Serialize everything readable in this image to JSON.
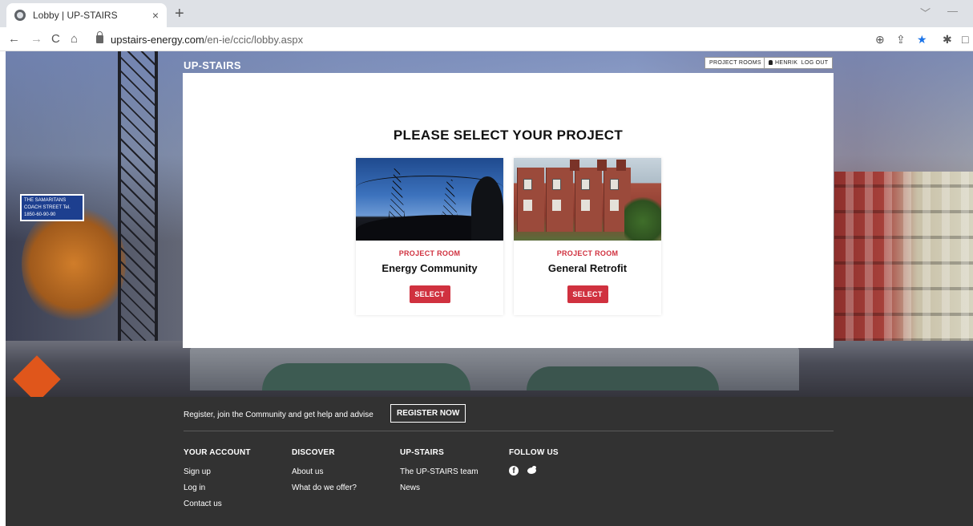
{
  "browser": {
    "tab_title": "Lobby | UP-STAIRS",
    "tab_close": "×",
    "new_tab": "+",
    "url_domain": "upstairs-energy.com",
    "url_path": "/en-ie/ccic/lobby.aspx",
    "nav": {
      "back": "←",
      "forward": "→",
      "reload": "C",
      "home": "⌂"
    },
    "extensions": {
      "zoom": "⊕",
      "share": "⇪",
      "bookmark": "★",
      "puzzle": "✱",
      "sidebar": "□"
    },
    "window": {
      "minimize": "—",
      "chevron": "﹀"
    }
  },
  "header": {
    "brand": "UP-STAIRS",
    "project_rooms_button": "PROJECT ROOMS",
    "user_name": "HENRIK",
    "logout_label": "LOG OUT"
  },
  "main": {
    "title": "PLEASE SELECT YOUR PROJECT",
    "rooms": [
      {
        "label": "PROJECT ROOM",
        "name": "Energy Community",
        "button": "SELECT",
        "image": "power-lines-photo"
      },
      {
        "label": "PROJECT ROOM",
        "name": "General Retrofit",
        "button": "SELECT",
        "image": "terraced-houses-photo"
      }
    ]
  },
  "hero": {
    "street_sign": "THE SAMARITANS COACH STREET Tel. 1850-60-90-90"
  },
  "footer": {
    "register_text": "Register, join the Community and get help and advise",
    "register_button": "REGISTER NOW",
    "columns": [
      {
        "heading": "YOUR ACCOUNT",
        "links": [
          "Sign up",
          "Log in",
          "Contact us"
        ]
      },
      {
        "heading": "DISCOVER",
        "links": [
          "About us",
          "What do we offer?"
        ]
      },
      {
        "heading": "UP-STAIRS",
        "links": [
          "The UP-STAIRS team",
          "News"
        ]
      },
      {
        "heading": "FOLLOW US",
        "links": []
      }
    ],
    "social": {
      "facebook": "f",
      "twitter": "twitter-icon"
    }
  },
  "colors": {
    "accent_red": "#d0313f",
    "footer_bg": "#323232",
    "chrome_tabbar": "#dee1e6"
  }
}
